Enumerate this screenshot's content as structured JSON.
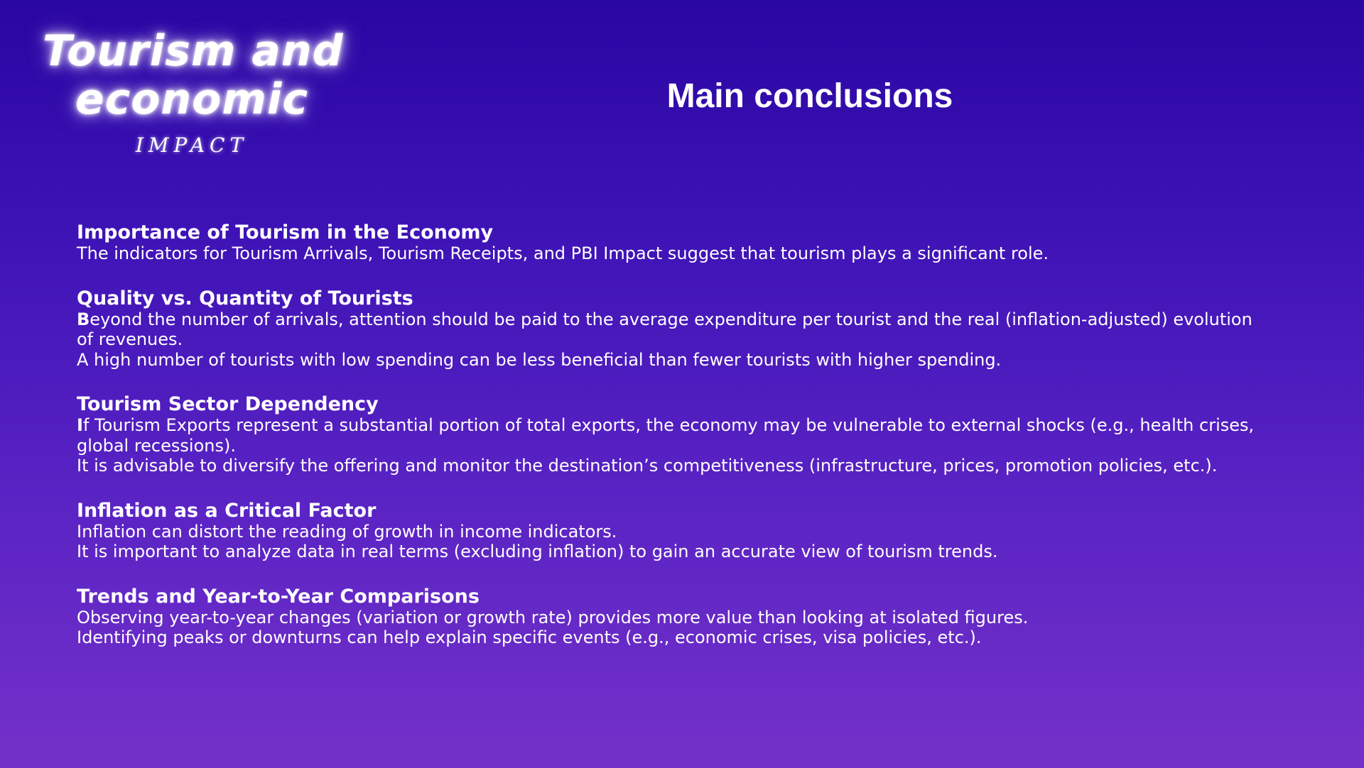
{
  "logo": {
    "title_line1": "Tourism and",
    "title_line2": "economic",
    "subtitle": "IMPACT"
  },
  "main_title": "Main conclusions",
  "sections": [
    {
      "heading": "Importance of Tourism in the Economy",
      "paragraphs": [
        {
          "lead": "",
          "text": "The indicators for Tourism Arrivals, Tourism Receipts, and PBI Impact suggest that tourism plays a significant role."
        }
      ]
    },
    {
      "heading": "Quality vs. Quantity of Tourists",
      "paragraphs": [
        {
          "lead": "B",
          "text": "eyond the number of arrivals, attention should be paid to the average expenditure per tourist and the real (inflation-adjusted) evolution of revenues."
        },
        {
          "lead": "",
          "text": "A high number of tourists with low spending can be less beneficial than fewer tourists with higher spending."
        }
      ]
    },
    {
      "heading": "Tourism Sector Dependency",
      "paragraphs": [
        {
          "lead": "I",
          "text": "f Tourism Exports represent a substantial portion of total exports, the economy may be vulnerable to external shocks (e.g., health crises, global recessions)."
        },
        {
          "lead": "",
          "text": "It is advisable to diversify the offering and monitor the destination’s competitiveness (infrastructure, prices, promotion policies, etc.)."
        }
      ]
    },
    {
      "heading": "Inflation as a Critical Factor",
      "paragraphs": [
        {
          "lead": "",
          "text": "Inflation can distort the reading of growth in income indicators."
        },
        {
          "lead": "",
          "text": "It is important to analyze data in real terms (excluding inflation) to gain an accurate view of tourism trends."
        }
      ]
    },
    {
      "heading": "Trends and Year-to-Year Comparisons",
      "paragraphs": [
        {
          "lead": "",
          "text": "Observing year-to-year changes (variation or growth rate) provides more value than looking at isolated figures."
        },
        {
          "lead": "",
          "text": "Identifying peaks or downturns can help explain specific events (e.g., economic crises, visa policies, etc.)."
        }
      ]
    }
  ],
  "colors": {
    "background_top": "#2a06a2",
    "background_bottom": "#7431c9",
    "text": "#ffffff"
  }
}
